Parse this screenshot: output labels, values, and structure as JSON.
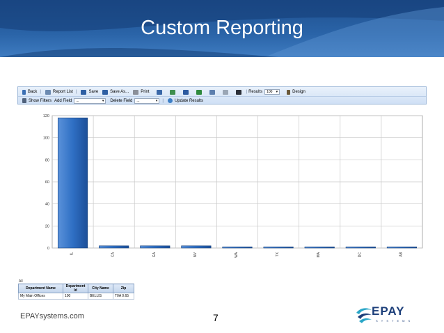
{
  "slide": {
    "title": "Custom Reporting",
    "footer_site": "EPAYsystems.com",
    "page_number": "7"
  },
  "toolbar": {
    "back": "Back",
    "report_list": "Report List",
    "save": "Save",
    "save_as": "Save As...",
    "print": "Print",
    "results_label": "Results",
    "results_value": "100",
    "design": "Design",
    "show_filters": "Show Filters",
    "add_field": "Add Field",
    "add_field_value": "...",
    "delete_field": "Delete Field",
    "delete_field_value": "...",
    "update_results": "Update Results"
  },
  "chart_data": {
    "type": "bar",
    "categories": [
      "IL",
      "CA",
      "GA",
      "NV",
      "WA",
      "TX",
      "MA",
      "DC",
      "AB"
    ],
    "values": [
      118,
      2,
      2,
      2,
      1,
      1,
      1,
      1,
      1
    ],
    "ylim": [
      0,
      120
    ],
    "yticks": [
      0,
      20,
      40,
      60,
      80,
      100,
      120
    ],
    "grid": true,
    "bar_color": "#2f6fc4"
  },
  "table": {
    "caption": "All",
    "columns": [
      "Department Name",
      "Department Id",
      "City Name",
      "Zip"
    ],
    "rows": [
      [
        "My Main Offices",
        "100",
        "BELLIS",
        "T0A 0.65"
      ]
    ]
  },
  "logo": {
    "name": "EPAY",
    "sub": "SYSTEMS",
    "color": "#1d3f7a",
    "accent": "#2aa6c7"
  }
}
